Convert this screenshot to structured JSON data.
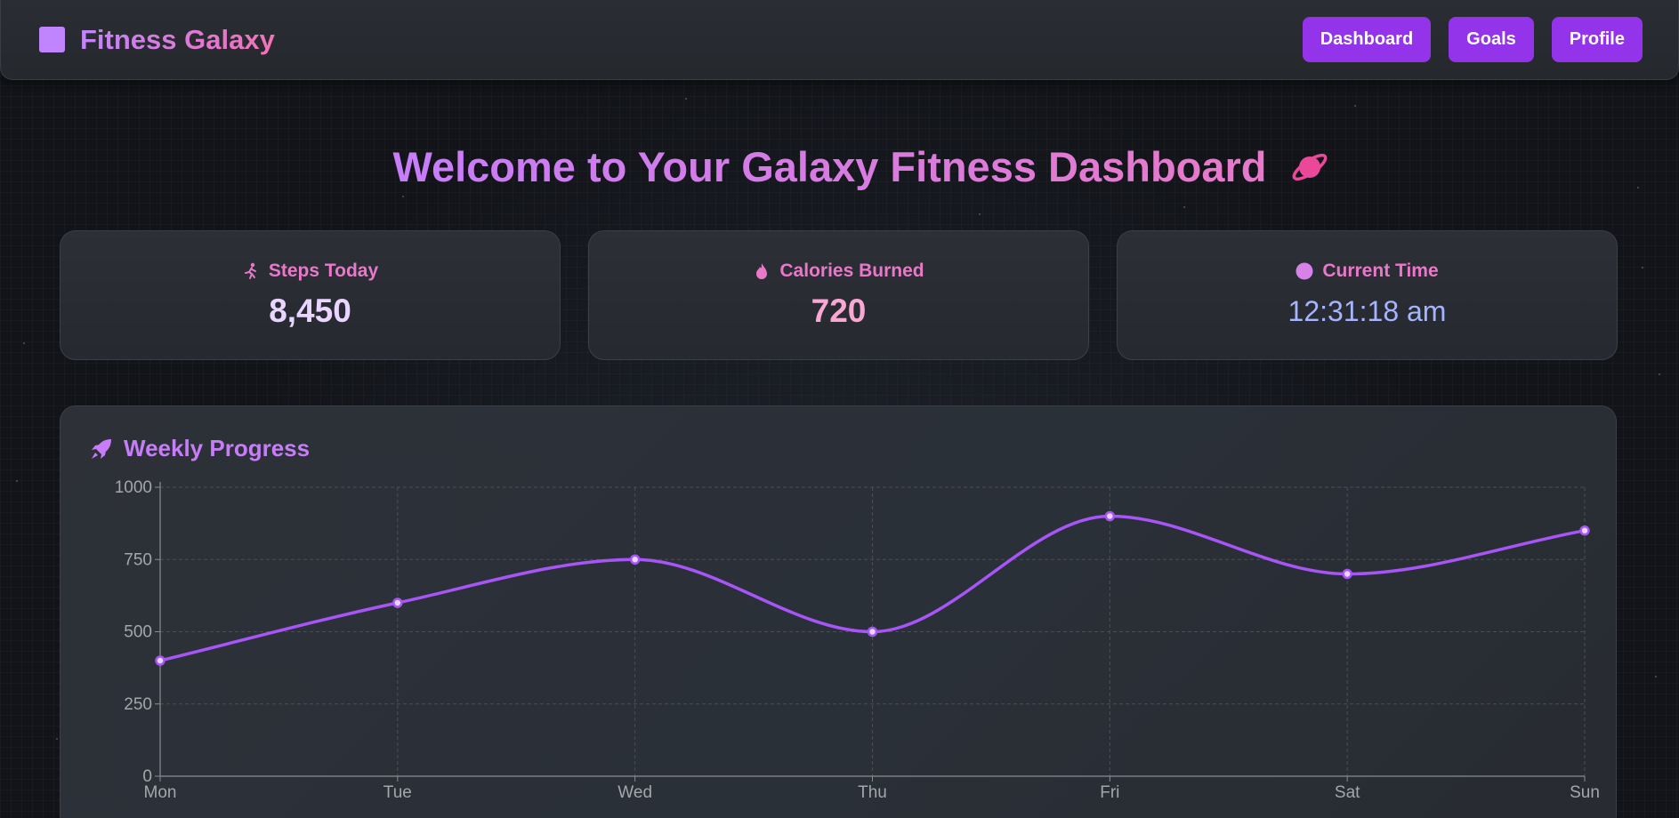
{
  "app": {
    "brand": "Fitness Galaxy",
    "logo_icon": "square-logo-icon"
  },
  "nav": {
    "items": [
      {
        "label": "Dashboard"
      },
      {
        "label": "Goals"
      },
      {
        "label": "Profile"
      }
    ]
  },
  "headline": {
    "text": "Welcome to Your Galaxy Fitness Dashboard",
    "icon": "ringed-planet-icon"
  },
  "stats": {
    "steps": {
      "label": "Steps Today",
      "value": "8,450",
      "icon": "running-person-icon"
    },
    "calories": {
      "label": "Calories Burned",
      "value": "720",
      "icon": "flame-icon"
    },
    "time": {
      "label": "Current Time",
      "value": "12:31:18 am",
      "icon": "clock-icon"
    }
  },
  "chart_panel": {
    "title": "Weekly Progress",
    "icon": "rocket-icon"
  },
  "colors": {
    "accent": "#9333ea",
    "line": "#a855f7",
    "title_pink": "#e879c9",
    "title_purple": "#c77dfa"
  },
  "chart_data": {
    "type": "line",
    "categories": [
      "Mon",
      "Tue",
      "Wed",
      "Thu",
      "Fri",
      "Sat",
      "Sun"
    ],
    "series": [
      {
        "values": [
          400,
          600,
          750,
          500,
          900,
          700,
          850
        ]
      }
    ],
    "y_ticks": [
      0,
      250,
      500,
      750,
      1000
    ],
    "ylim": [
      0,
      1000
    ],
    "grid": true,
    "smooth": true,
    "legend": "none"
  }
}
